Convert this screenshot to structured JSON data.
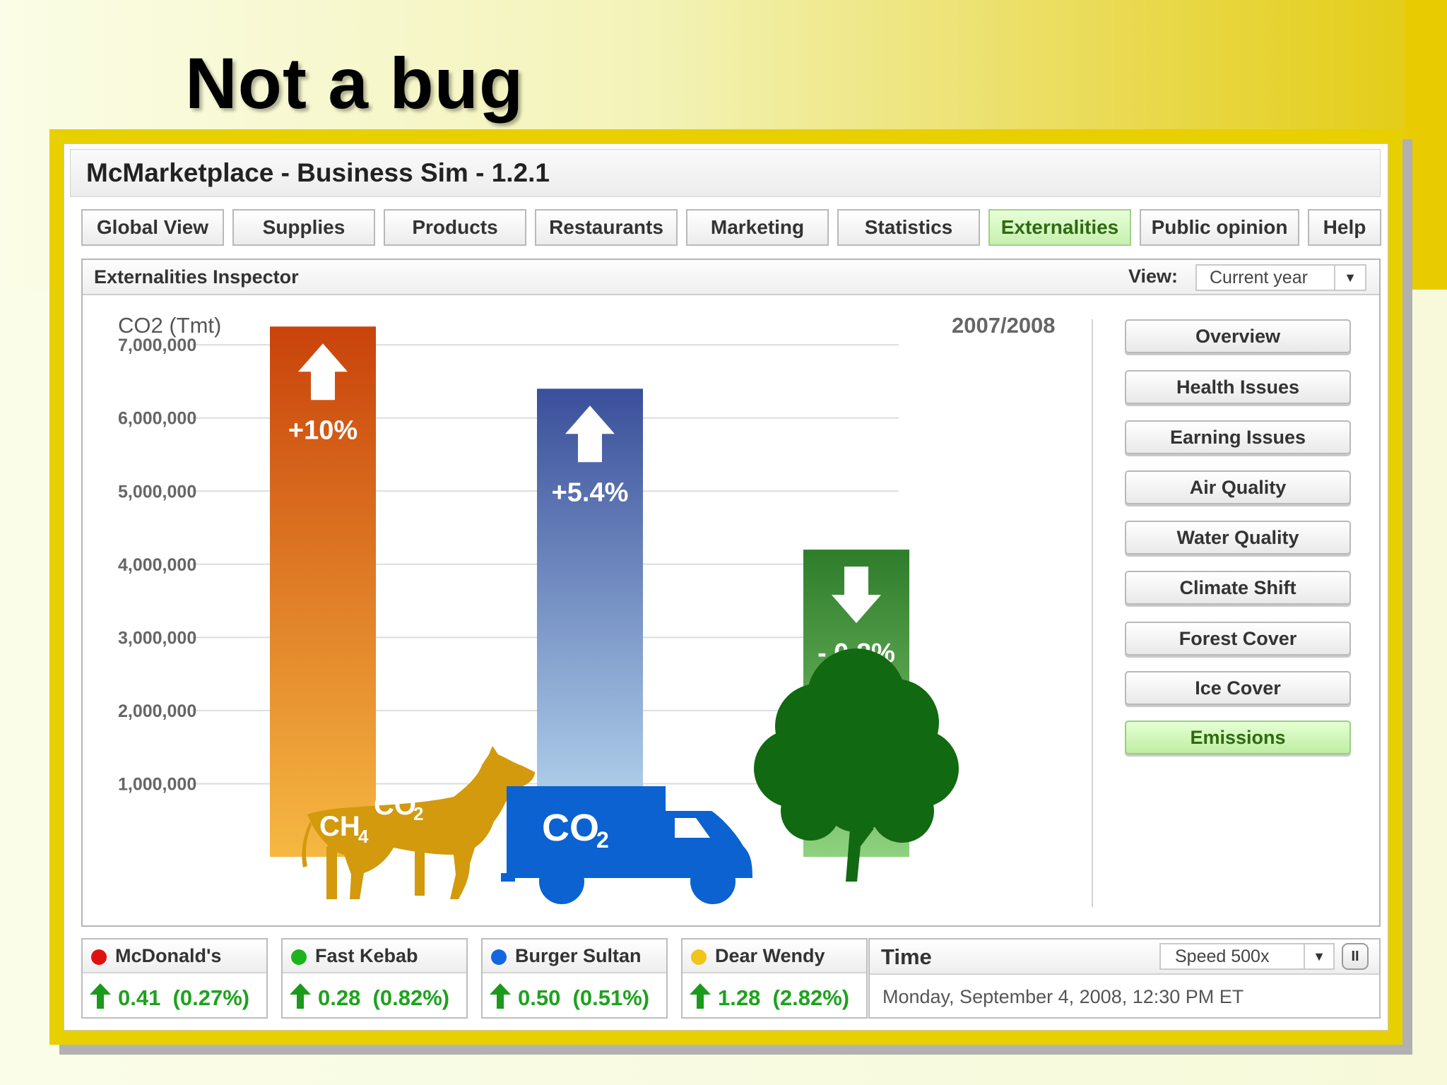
{
  "slide": {
    "title": "Not a bug"
  },
  "window": {
    "title": "McMarketplace - Business Sim - 1.2.1"
  },
  "tabs": [
    {
      "label": "Global View",
      "active": false
    },
    {
      "label": "Supplies",
      "active": false
    },
    {
      "label": "Products",
      "active": false
    },
    {
      "label": "Restaurants",
      "active": false
    },
    {
      "label": "Marketing",
      "active": false
    },
    {
      "label": "Statistics",
      "active": false
    },
    {
      "label": "Externalities",
      "active": true
    },
    {
      "label": "Public opinion",
      "active": false
    },
    {
      "label": "Help",
      "active": false
    }
  ],
  "inspector": {
    "title": "Externalities Inspector",
    "view_label": "View:",
    "view_value": "Current year"
  },
  "chart_data": {
    "type": "bar",
    "title": "CO2 (Tmt)",
    "period": "2007/2008",
    "yticks": [
      "7,000,000",
      "6,000,000",
      "5,000,000",
      "4,000,000",
      "3,000,000",
      "2,000,000",
      "1,000,000"
    ],
    "ytick_values": [
      7000000,
      6000000,
      5000000,
      4000000,
      3000000,
      2000000,
      1000000
    ],
    "ylim": [
      0,
      7250000
    ],
    "bars": [
      {
        "value": 7250000,
        "change_label": "+10%",
        "direction": "up",
        "color_top": "#c9430b",
        "color_bottom": "#f6b842",
        "icon": "cow-icon",
        "icon_labels": [
          "CH",
          "4",
          "CO",
          "2"
        ],
        "icon_color": "#d29a0c"
      },
      {
        "value": 6400000,
        "change_label": "+5.4%",
        "direction": "up",
        "color_top": "#3a4f9a",
        "color_bottom": "#bfe1f6",
        "icon": "truck-icon",
        "icon_labels": [
          "CO",
          "2"
        ],
        "icon_color": "#0b62d0"
      },
      {
        "value": 4200000,
        "change_label": "- 0.8%",
        "direction": "down",
        "color_top": "#2e7d2a",
        "color_bottom": "#8ed17e",
        "icon": "tree-icon",
        "icon_labels": [],
        "icon_color": "#116911"
      }
    ]
  },
  "side_buttons": [
    {
      "label": "Overview",
      "active": false
    },
    {
      "label": "Health Issues",
      "active": false
    },
    {
      "label": "Earning Issues",
      "active": false
    },
    {
      "label": "Air Quality",
      "active": false
    },
    {
      "label": "Water Quality",
      "active": false
    },
    {
      "label": "Climate Shift",
      "active": false
    },
    {
      "label": "Forest Cover",
      "active": false
    },
    {
      "label": "Ice Cover",
      "active": false
    },
    {
      "label": "Emissions",
      "active": true
    }
  ],
  "companies": [
    {
      "name": "McDonald's",
      "dot_color": "#e01010",
      "value": "0.41  (0.27%)",
      "trend": "up"
    },
    {
      "name": "Fast Kebab",
      "dot_color": "#1cb41c",
      "value": "0.28  (0.82%)",
      "trend": "up"
    },
    {
      "name": "Burger Sultan",
      "dot_color": "#1466e0",
      "value": "0.50  (0.51%)",
      "trend": "up"
    },
    {
      "name": "Dear Wendy",
      "dot_color": "#f0c419",
      "value": "1.28  (2.82%)",
      "trend": "up"
    }
  ],
  "time": {
    "title": "Time",
    "speed": "Speed 500x",
    "pause_icon": "II",
    "datetime": "Monday, September 4, 2008, 12:30 PM ET"
  }
}
